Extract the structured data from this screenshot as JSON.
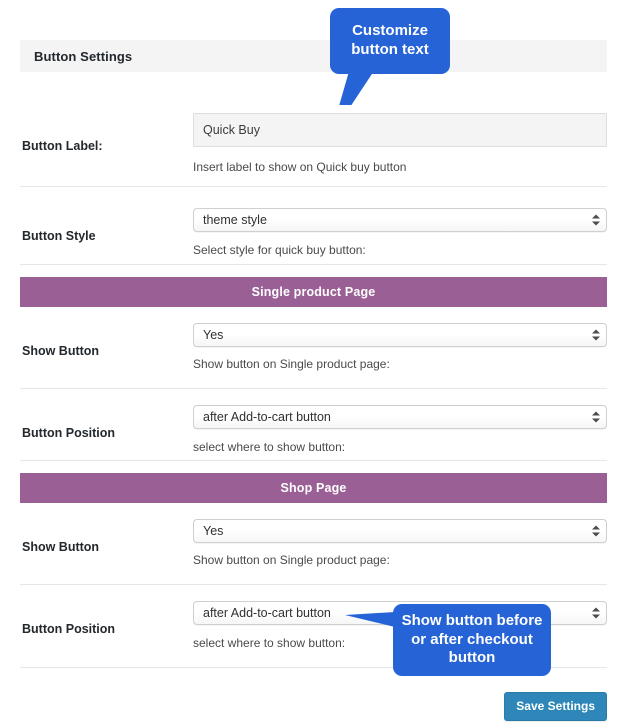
{
  "panel": {
    "title": "Button Settings"
  },
  "rows": [
    {
      "label": "Button Label:",
      "control_type": "text",
      "value": "Quick Buy",
      "placeholder": "",
      "hint": "Insert label to show on Quick buy button"
    },
    {
      "label": "Button Style",
      "control_type": "select",
      "value": "theme style",
      "hint": "Select style for quick buy button:"
    },
    {
      "label": "Show Button",
      "control_type": "select",
      "value": "Yes",
      "hint": "Show button on Single product page:"
    },
    {
      "label": "Button Position",
      "control_type": "select",
      "value": "after Add-to-cart button",
      "hint": "select where to show button:"
    },
    {
      "label": "Show Button",
      "control_type": "select",
      "value": "Yes",
      "hint": "Show button on Single product page:"
    },
    {
      "label": "Button Position",
      "control_type": "select",
      "value": "after Add-to-cart button",
      "hint": "select where to show button:"
    }
  ],
  "sections": [
    {
      "title": "Single product Page"
    },
    {
      "title": "Shop Page"
    }
  ],
  "tooltips": [
    {
      "text": "Customize button text"
    },
    {
      "text": "Show button before or after checkout button"
    }
  ],
  "footer": {
    "save_label": "Save Settings"
  },
  "colors": {
    "section_bar": "#9a5f94",
    "tooltip": "#2563d6",
    "save_button": "#2e87b8",
    "panel_header": "#f4f4f4",
    "input_background": "#f4f4f4"
  }
}
